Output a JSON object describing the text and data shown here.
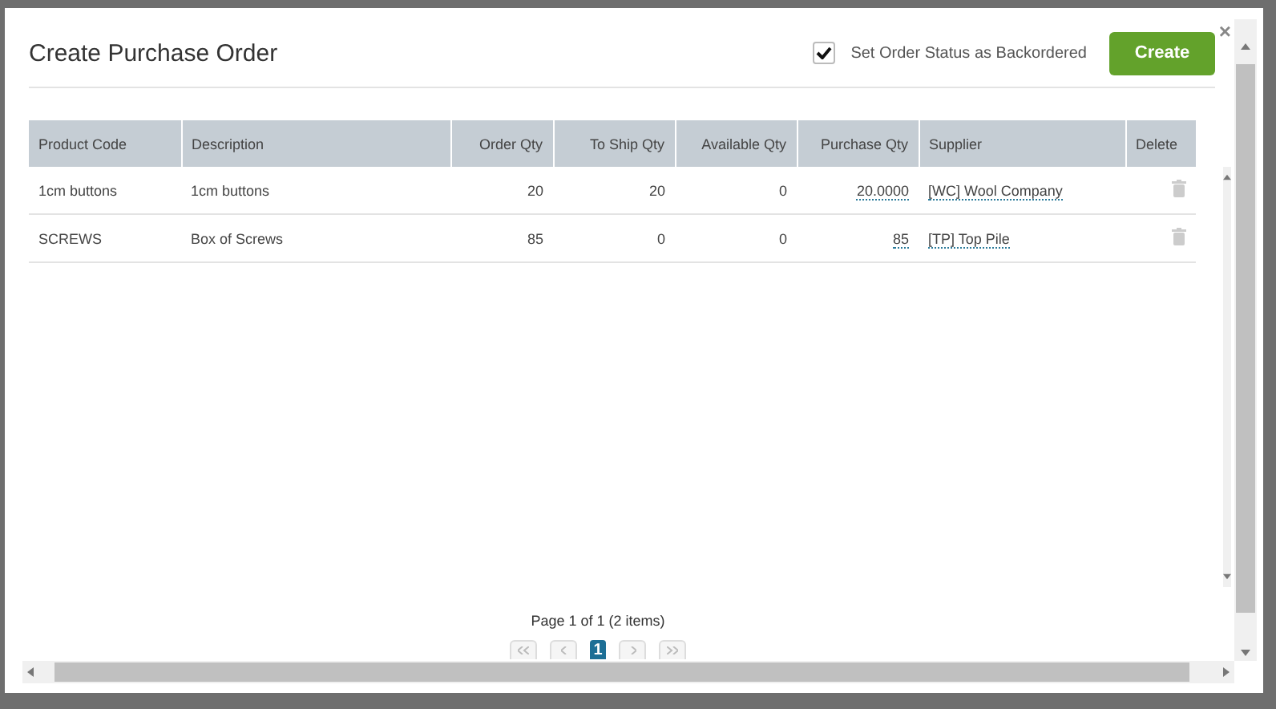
{
  "dialog": {
    "title": "Create Purchase Order",
    "close": "×"
  },
  "backorder": {
    "label": "Set Order Status as Backordered",
    "checked": true
  },
  "create_button": "Create",
  "table": {
    "columns": [
      "Product Code",
      "Description",
      "Order Qty",
      "To Ship Qty",
      "Available Qty",
      "Purchase Qty",
      "Supplier",
      "Delete"
    ],
    "rows": [
      {
        "product_code": "1cm buttons",
        "description": "1cm buttons",
        "order_qty": "20",
        "to_ship_qty": "20",
        "available_qty": "0",
        "purchase_qty": "20.0000",
        "supplier": "[WC] Wool Company"
      },
      {
        "product_code": "SCREWS",
        "description": "Box of Screws",
        "order_qty": "85",
        "to_ship_qty": "0",
        "available_qty": "0",
        "purchase_qty": "85",
        "supplier": "[TP] Top Pile"
      }
    ]
  },
  "pager": {
    "summary": "Page 1 of 1 (2 items)",
    "pages": [
      {
        "label": "1",
        "selected": true
      }
    ]
  }
}
